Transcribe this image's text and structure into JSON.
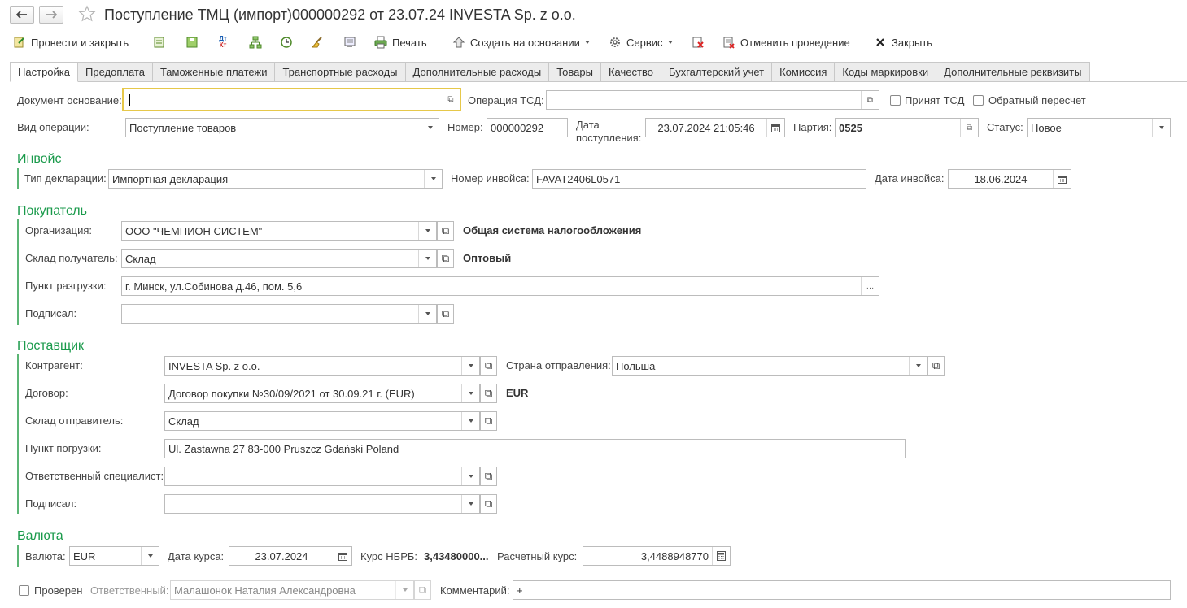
{
  "window": {
    "title": "Поступление ТМЦ (импорт)000000292 от 23.07.24 INVESTA Sp. z o.o."
  },
  "toolbar": {
    "post_close": "Провести и закрыть",
    "print": "Печать",
    "create_based_on": "Создать на основании",
    "service": "Сервис",
    "cancel_posting": "Отменить проведение",
    "close": "Закрыть"
  },
  "tabs": [
    "Настройка",
    "Предоплата",
    "Таможенные платежи",
    "Транспортные расходы",
    "Дополнительные расходы",
    "Товары",
    "Качество",
    "Бухгалтерский учет",
    "Комиссия",
    "Коды маркировки",
    "Дополнительные реквизиты"
  ],
  "header": {
    "doc_basis_label": "Документ основание:",
    "doc_basis_value": "",
    "tsd_operation_label": "Операция ТСД:",
    "tsd_operation_value": "",
    "accepted_tsd_label": "Принят ТСД",
    "reverse_recalc_label": "Обратный пересчет",
    "operation_type_label": "Вид операции:",
    "operation_type_value": "Поступление товаров",
    "number_label": "Номер:",
    "number_value": "000000292",
    "receipt_date_label_1": "Дата",
    "receipt_date_label_2": "поступления:",
    "receipt_date_value": "23.07.2024 21:05:46",
    "batch_label": "Партия:",
    "batch_value": "0525",
    "status_label": "Статус:",
    "status_value": "Новое"
  },
  "invoice": {
    "section_title": "Инвойс",
    "declaration_type_label": "Тип декларации:",
    "declaration_type_value": "Импортная декларация",
    "invoice_number_label": "Номер инвойса:",
    "invoice_number_value": "FAVAT2406L0571",
    "invoice_date_label": "Дата инвойса:",
    "invoice_date_value": "18.06.2024"
  },
  "buyer": {
    "section_title": "Покупатель",
    "organization_label": "Организация:",
    "organization_value": "ООО \"ЧЕМПИОН СИСТЕМ\"",
    "tax_system_text": "Общая система налогообложения",
    "recipient_warehouse_label": "Склад получатель:",
    "recipient_warehouse_value": "Склад",
    "wholesale_text": "Оптовый",
    "unloading_point_label": "Пункт разгрузки:",
    "unloading_point_value": "г. Минск, ул.Собинова д.46, пом. 5,6",
    "signed_label": "Подписал:",
    "signed_value": ""
  },
  "supplier": {
    "section_title": "Поставщик",
    "counterparty_label": "Контрагент:",
    "counterparty_value": "INVESTA Sp. z o.o.",
    "departure_country_label": "Страна отправления:",
    "departure_country_value": "Польша",
    "contract_label": "Договор:",
    "contract_value": "Договор покупки №30/09/2021 от 30.09.21 г. (EUR)",
    "contract_currency": "EUR",
    "sender_warehouse_label": "Склад отправитель:",
    "sender_warehouse_value": "Склад",
    "loading_point_label": "Пункт погрузки:",
    "loading_point_value": "Ul. Zastawna 27 83-000 Pruszcz Gdański Poland",
    "responsible_label": "Ответственный специалист:",
    "responsible_value": "",
    "signed_label": "Подписал:",
    "signed_value": ""
  },
  "currency": {
    "section_title": "Валюта",
    "currency_label": "Валюта:",
    "currency_value": "EUR",
    "rate_date_label": "Дата курса:",
    "rate_date_value": "23.07.2024",
    "nbrb_rate_label": "Курс НБРБ:",
    "nbrb_rate_value": "3,43480000...",
    "calc_rate_label": "Расчетный курс:",
    "calc_rate_value": "3,4488948770"
  },
  "footer": {
    "checked_label": "Проверен",
    "responsible_label": "Ответственный:",
    "responsible_value": "Малашонок Наталия Александровна",
    "comment_label": "Комментарий:",
    "comment_value": "+"
  },
  "colors": {
    "section_green": "#1a9a4b",
    "focus_border": "#e6c84a"
  }
}
